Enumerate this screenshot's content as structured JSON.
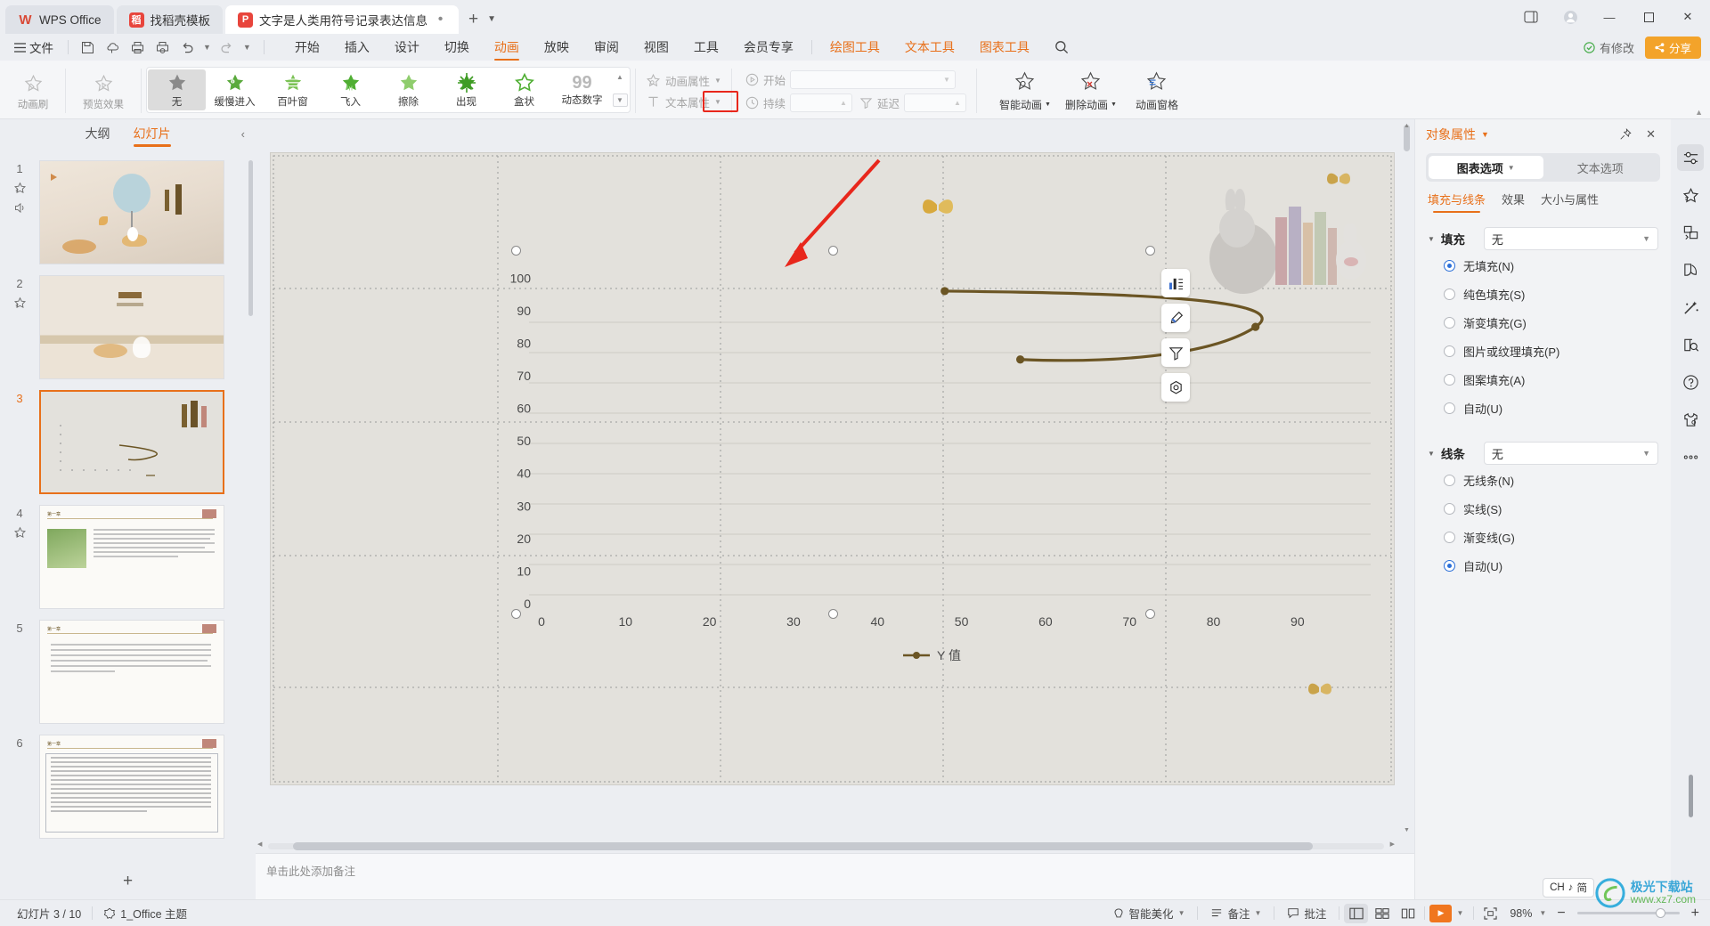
{
  "window": {
    "tabs": [
      {
        "label": "WPS Office",
        "icon": "wps-logo-icon"
      },
      {
        "label": "找稻壳模板",
        "icon": "template-icon"
      },
      {
        "label": "文字是人类用符号记录表达信息以",
        "icon": "ppt-file-icon"
      }
    ],
    "new_tab": "+",
    "controls": {
      "minimize": "—",
      "maximize": "□",
      "close": "✕",
      "sidebar": "▯"
    }
  },
  "quickaccess": {
    "file_menu": "文件",
    "menu_icon": "hamburger-icon",
    "buttons": [
      "save-icon",
      "cloud-sync-icon",
      "print-icon",
      "print-preview-icon",
      "undo-icon",
      "redo-icon",
      "more-icon"
    ]
  },
  "menubar": {
    "items": [
      {
        "label": "开始",
        "state": "normal"
      },
      {
        "label": "插入",
        "state": "normal"
      },
      {
        "label": "设计",
        "state": "normal"
      },
      {
        "label": "切换",
        "state": "normal"
      },
      {
        "label": "动画",
        "state": "active"
      },
      {
        "label": "放映",
        "state": "normal"
      },
      {
        "label": "审阅",
        "state": "normal"
      },
      {
        "label": "视图",
        "state": "normal"
      },
      {
        "label": "工具",
        "state": "normal"
      },
      {
        "label": "会员专享",
        "state": "normal"
      },
      {
        "label": "绘图工具",
        "state": "contextual"
      },
      {
        "label": "文本工具",
        "state": "contextual"
      },
      {
        "label": "图表工具",
        "state": "contextual"
      }
    ],
    "search": "搜索",
    "right": {
      "modified": "有修改",
      "share": "分享"
    }
  },
  "ribbon": {
    "left_buttons": [
      {
        "label": "动画刷",
        "icon": "animation-brush-icon",
        "enabled": false
      },
      {
        "label": "预览效果",
        "icon": "preview-effect-icon",
        "enabled": false,
        "dropdown": true
      }
    ],
    "gallery": [
      {
        "label": "无",
        "icon": "star-none-icon",
        "selected": true
      },
      {
        "label": "缓慢进入",
        "icon": "star-slow-enter-icon",
        "selected": false
      },
      {
        "label": "百叶窗",
        "icon": "star-blinds-icon",
        "selected": false
      },
      {
        "label": "飞入",
        "icon": "star-fly-in-icon",
        "selected": false
      },
      {
        "label": "擦除",
        "icon": "star-wipe-icon",
        "selected": false
      },
      {
        "label": "出现",
        "icon": "star-appear-icon",
        "selected": false
      },
      {
        "label": "盒状",
        "icon": "star-box-icon",
        "selected": false
      },
      {
        "label": "动态数字",
        "icon": "dynamic-number-icon",
        "selected": false
      }
    ],
    "gallery_scroll": {
      "up": "▲",
      "down": "▼"
    },
    "properties": [
      {
        "label": "动画属性",
        "icon": "animation-property-icon",
        "dropdown": true,
        "enabled": false
      },
      {
        "label": "文本属性",
        "icon": "text-property-icon",
        "dropdown": true,
        "enabled": false
      }
    ],
    "timing": [
      {
        "label": "开始",
        "icon": "play-circle-icon",
        "value": "",
        "enabled": false
      },
      {
        "label": "持续",
        "icon": "clock-icon",
        "value": "",
        "enabled": false
      },
      {
        "label": "延迟",
        "icon": "delay-icon",
        "value": "",
        "enabled": false
      }
    ],
    "right_buttons": [
      {
        "label": "智能动画",
        "icon": "smart-animation-icon",
        "dropdown": true
      },
      {
        "label": "删除动画",
        "icon": "delete-animation-icon",
        "dropdown": true
      },
      {
        "label": "动画窗格",
        "icon": "animation-pane-icon",
        "dropdown": false
      }
    ]
  },
  "thumbpanel": {
    "tabs": [
      {
        "label": "大纲",
        "active": false
      },
      {
        "label": "幻灯片",
        "active": true
      }
    ],
    "collapse_icon": "chevron-left-icon",
    "slides": [
      {
        "number": "1",
        "selected": false,
        "icons": [
          "animation-star-icon",
          "audio-icon"
        ],
        "kind": "cover"
      },
      {
        "number": "2",
        "selected": false,
        "icons": [
          "animation-star-icon"
        ],
        "kind": "contents"
      },
      {
        "number": "3",
        "selected": true,
        "icons": [],
        "kind": "chart"
      },
      {
        "number": "4",
        "selected": false,
        "icons": [
          "animation-star-icon"
        ],
        "kind": "photo-text"
      },
      {
        "number": "5",
        "selected": false,
        "icons": [],
        "kind": "text"
      },
      {
        "number": "6",
        "selected": false,
        "icons": [],
        "kind": "text-dense"
      }
    ],
    "add_slide": "+"
  },
  "chart_data": {
    "type": "scatter",
    "title": "",
    "xlabel": "",
    "ylabel": "",
    "xlim": [
      0,
      95
    ],
    "ylim": [
      0,
      105
    ],
    "xticks": [
      0,
      10,
      20,
      30,
      40,
      50,
      60,
      70,
      80,
      90
    ],
    "yticks": [
      0,
      10,
      20,
      30,
      40,
      50,
      60,
      70,
      80,
      90,
      100
    ],
    "grid": true,
    "legend": {
      "entries": [
        "Y 值"
      ],
      "position": "bottom"
    },
    "series": [
      {
        "name": "Y 值",
        "color": "#6b5524",
        "smooth": true,
        "markers": true,
        "points": [
          {
            "x": 48,
            "y": 96
          },
          {
            "x": 85,
            "y": 85
          },
          {
            "x": 57,
            "y": 75
          }
        ]
      }
    ]
  },
  "chart_tools": [
    {
      "icon": "chart-elements-icon",
      "name": "chart-elements"
    },
    {
      "icon": "chart-style-icon",
      "name": "chart-style"
    },
    {
      "icon": "chart-filter-icon",
      "name": "chart-filter"
    },
    {
      "icon": "chart-settings-icon",
      "name": "chart-settings"
    }
  ],
  "properties_panel": {
    "title": "对象属性",
    "title_caret": "▾",
    "pin_icon": "pin-icon",
    "close_icon": "close-icon",
    "segments": [
      {
        "label": "图表选项",
        "active": true,
        "caret": "▾"
      },
      {
        "label": "文本选项",
        "active": false
      }
    ],
    "tabs": [
      {
        "label": "填充与线条",
        "active": true
      },
      {
        "label": "效果",
        "active": false
      },
      {
        "label": "大小与属性",
        "active": false
      }
    ],
    "fill": {
      "heading": "填充",
      "selected_value": "无",
      "options": [
        {
          "label": "无填充(N)",
          "checked": true
        },
        {
          "label": "纯色填充(S)",
          "checked": false
        },
        {
          "label": "渐变填充(G)",
          "checked": false
        },
        {
          "label": "图片或纹理填充(P)",
          "checked": false
        },
        {
          "label": "图案填充(A)",
          "checked": false
        },
        {
          "label": "自动(U)",
          "checked": false
        }
      ]
    },
    "line": {
      "heading": "线条",
      "selected_value": "无",
      "options": [
        {
          "label": "无线条(N)",
          "checked": false
        },
        {
          "label": "实线(S)",
          "checked": false
        },
        {
          "label": "渐变线(G)",
          "checked": false
        },
        {
          "label": "自动(U)",
          "checked": true
        }
      ]
    }
  },
  "rail": [
    {
      "icon": "settings-sliders-icon",
      "active": true
    },
    {
      "icon": "animation-star-icon",
      "active": false
    },
    {
      "icon": "shape-layers-icon",
      "active": false
    },
    {
      "icon": "feather-icon",
      "active": false
    },
    {
      "icon": "magic-wand-icon",
      "active": false
    },
    {
      "icon": "book-search-icon",
      "active": false
    },
    {
      "icon": "help-circle-icon",
      "active": false
    },
    {
      "icon": "skin-icon",
      "active": false
    },
    {
      "icon": "more-dots-icon",
      "active": false
    }
  ],
  "notes_placeholder": "单击此处添加备注",
  "statusbar": {
    "slide_counter": "幻灯片 3 / 10",
    "theme_icon": "theme-icon",
    "theme": "1_Office 主题",
    "beautify": "智能美化",
    "notes": "备注",
    "comments": "批注",
    "views": [
      {
        "icon": "normal-view-icon",
        "active": true
      },
      {
        "icon": "slide-sorter-icon",
        "active": false
      },
      {
        "icon": "reading-view-icon",
        "active": false
      }
    ],
    "play_icon": "play-icon",
    "fit_icon": "fit-slide-icon",
    "zoom": "98%",
    "zoom_out": "−",
    "zoom_in": "+"
  },
  "ime": {
    "label": "CH",
    "sub": "简",
    "icon": "ime-icon"
  },
  "watermark": {
    "name": "极光下载站",
    "url": "www.xz7.com"
  },
  "colors": {
    "accent": "#e8701a",
    "chart_line": "#6b5524",
    "radio_blue": "#2b6fd8",
    "highlight_red": "#e8271c",
    "slide_bg": "#e3e1dc"
  }
}
